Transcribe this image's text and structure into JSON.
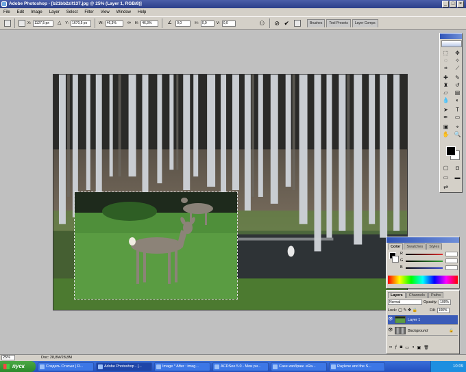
{
  "window": {
    "title": "Adobe Photoshop - [b21bb2zif137.jpg @ 25% (Layer 1, RGB/8)]",
    "minimize": "_",
    "maximize": "□",
    "close": "×"
  },
  "menu": [
    "File",
    "Edit",
    "Image",
    "Layer",
    "Select",
    "Filter",
    "View",
    "Window",
    "Help"
  ],
  "options": {
    "x_label": "X:",
    "x_value": "1127,5 px",
    "y_label": "Y:",
    "y_value": "1670,5 px",
    "w_label": "W:",
    "w_value": "46,3%",
    "h_label": "H:",
    "h_value": "46,3%",
    "angle_value": "0,0",
    "hskew_label": "H:",
    "hskew_value": "0,0",
    "vskew_label": "V:",
    "vskew_value": "0,0"
  },
  "palette_well": [
    "Brushes",
    "Tool Presets",
    "Layer Comps"
  ],
  "color_panel": {
    "tabs": [
      "Color",
      "Swatches",
      "Styles"
    ],
    "sliders": [
      {
        "label": "R",
        "color": "#e03030"
      },
      {
        "label": "G",
        "color": "#30a030"
      },
      {
        "label": "B",
        "color": "#3040d0"
      }
    ]
  },
  "layers_panel": {
    "tabs": [
      "Layers",
      "Channels",
      "Paths"
    ],
    "blend_mode": "Normal",
    "opacity_label": "Opacity:",
    "opacity_value": "100%",
    "lock_label": "Lock:",
    "fill_label": "Fill:",
    "fill_value": "100%",
    "layers": [
      {
        "name": "Layer 1",
        "selected": true
      },
      {
        "name": "Background",
        "selected": false
      }
    ]
  },
  "status": {
    "zoom": "25%",
    "doc": "Doc: 28,8M/28,8M"
  },
  "taskbar": {
    "start_label": "пуск",
    "buttons": [
      "Создать Статью | R...",
      "Adobe Photoshop - [...",
      "Image * After : imag...",
      "ACDSee 5.0 - Мои ри...",
      "Case изображ. eRa...",
      "Raylene and the S..."
    ],
    "active_index": 1,
    "clock": "10:09"
  },
  "colors": {
    "accent": "#2b3f8a",
    "layer_selected": "#3a5bb8"
  }
}
